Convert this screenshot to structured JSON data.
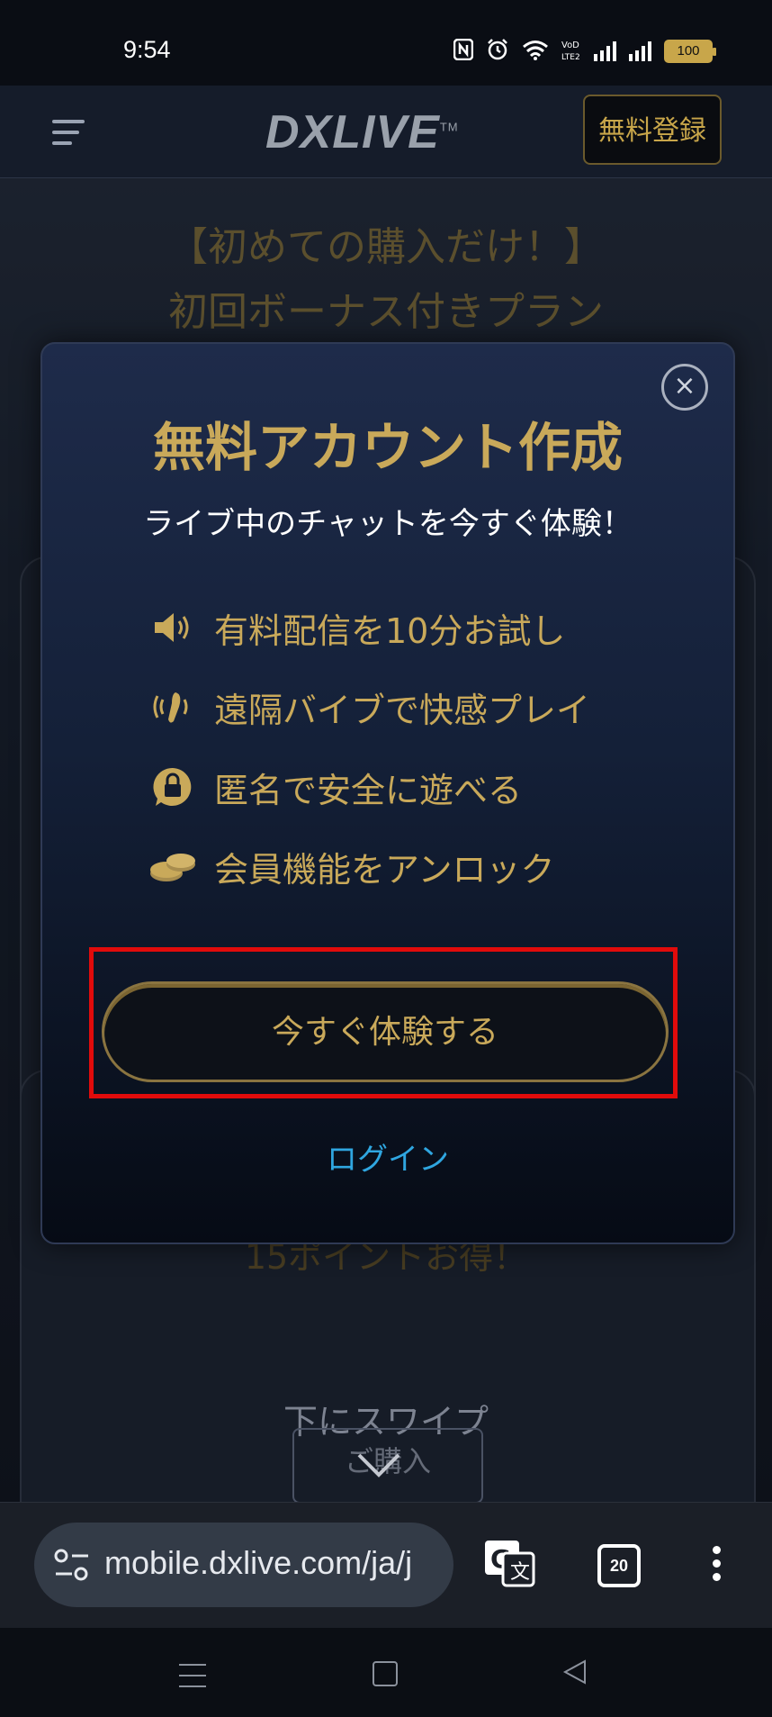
{
  "status_bar": {
    "time": "9:54",
    "battery": "100"
  },
  "header": {
    "logo": "DXLIVE",
    "trademark": "TM",
    "register_button": "無料登録"
  },
  "background_page": {
    "promo_line1": "【初めての購入だけ！】",
    "promo_line2": "初回ボーナス付きプラン",
    "points_text": "15ポイントお得！",
    "swipe_text": "下にスワイプ",
    "buy_button": "ご購入"
  },
  "modal": {
    "title": "無料アカウント作成",
    "subtitle": "ライブ中のチャットを今すぐ体験！",
    "features": [
      {
        "icon": "speaker-icon",
        "label": "有料配信を10分お試し"
      },
      {
        "icon": "vibe-icon",
        "label": "遠隔バイブで快感プレイ"
      },
      {
        "icon": "lock-icon",
        "label": "匿名で安全に遊べる"
      },
      {
        "icon": "coins-icon",
        "label": "会員機能をアンロック"
      }
    ],
    "cta_button": "今すぐ体験する",
    "login_link": "ログイン",
    "close_symbol": "×"
  },
  "browser_bar": {
    "url": "mobile.dxlive.com/ja/j",
    "tab_count": "20"
  },
  "colors": {
    "gold": "#c9a95a",
    "highlight_red": "#e10b0b",
    "link_blue": "#2fa6e0"
  }
}
